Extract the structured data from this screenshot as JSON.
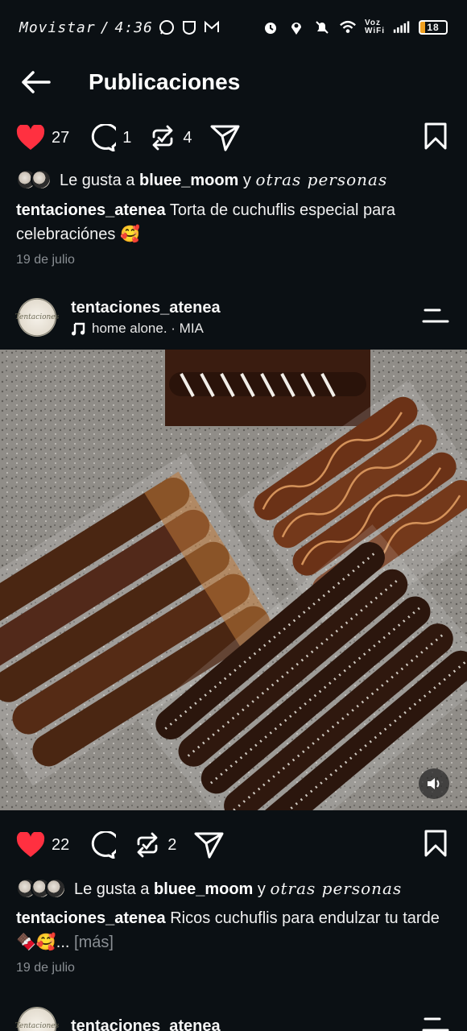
{
  "status_bar": {
    "carrier": "Movistar",
    "time": "4:36",
    "voz_top": "Voz",
    "voz_bottom": "WiFi",
    "battery": "18",
    "icons": [
      "whatsapp-icon",
      "shield-icon",
      "gmail-icon",
      "alarm-icon",
      "location-icon",
      "mute-icon",
      "wifi-icon",
      "signal-icon",
      "battery-icon"
    ]
  },
  "header": {
    "title": "Publicaciones"
  },
  "posts": [
    {
      "likes": "27",
      "comments": "1",
      "reposts": "4",
      "liked_by_prefix": "Le gusta a",
      "liked_by_user": "bluee_moom",
      "liked_by_connector": "y",
      "liked_by_suffix": "otras personas",
      "caption_user": "tentaciones_atenea",
      "caption_text": "Torta de cuchuflis especial para celebraciónes 🥰",
      "date": "19 de julio"
    },
    {
      "author": "tentaciones_atenea",
      "avatar_text": "Tentaciones",
      "audio": "home alone. · MIA",
      "likes": "22",
      "comments": "",
      "reposts": "2",
      "liked_by_prefix": "Le gusta a",
      "liked_by_user": "bluee_moom",
      "liked_by_connector": "y",
      "liked_by_suffix": "otras personas",
      "caption_user": "tentaciones_atenea",
      "caption_text": "Ricos cuchuflis para endulzar tu tarde 🍫🥰...",
      "more_label": "[más]",
      "date": "19 de julio"
    },
    {
      "author": "tentaciones_atenea",
      "avatar_text": "Tentaciones"
    }
  ],
  "colors": {
    "like_red": "#ff3040",
    "background": "#0b1014",
    "muted": "#8a8f94"
  }
}
